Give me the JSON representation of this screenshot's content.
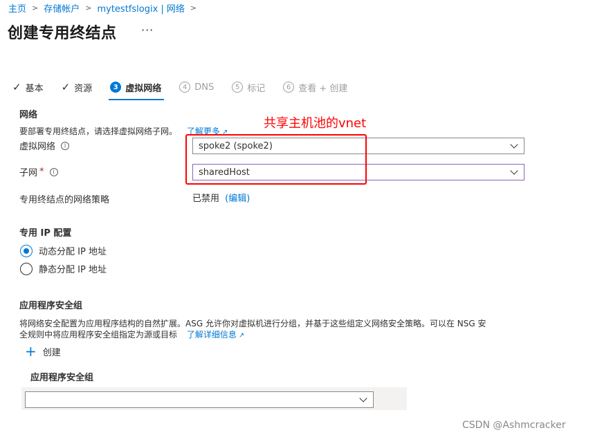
{
  "breadcrumb": {
    "home": "主页",
    "storage_accounts": "存储帐户",
    "resource": "mytestfslogix | 网络"
  },
  "page": {
    "title": "创建专用终结点",
    "more": "···"
  },
  "wizard": {
    "tabs": [
      {
        "label": "基本",
        "state": "done"
      },
      {
        "label": "资源",
        "state": "done"
      },
      {
        "number": "3",
        "label": "虚拟网络",
        "state": "active"
      },
      {
        "number": "4",
        "label": "DNS",
        "state": "disabled"
      },
      {
        "number": "5",
        "label": "标记",
        "state": "disabled"
      },
      {
        "number": "6",
        "label": "查看 + 创建",
        "state": "disabled"
      }
    ]
  },
  "network": {
    "title": "网络",
    "description": "要部署专用终结点，请选择虚拟网络子网。",
    "learn_more": "了解更多",
    "vnet_label": "虚拟网络",
    "vnet_value": "spoke2 (spoke2)",
    "subnet_label": "子网",
    "subnet_required": "*",
    "subnet_value": "sharedHost",
    "policy_label": "专用终结点的网络策略",
    "policy_value": "已禁用",
    "policy_edit": "(编辑)"
  },
  "annotation": {
    "text": "共享主机池的vnet",
    "color": "#ff0000"
  },
  "ip_config": {
    "title": "专用 IP 配置",
    "options": [
      {
        "label": "动态分配 IP 地址",
        "checked": true
      },
      {
        "label": "静态分配 IP 地址",
        "checked": false
      }
    ]
  },
  "asg": {
    "title": "应用程序安全组",
    "description_line1": "将网络安全配置为应用程序结构的自然扩展。ASG 允许你对虚拟机进行分组，并基于这些组定义网络安全策略。可以在 NSG 安",
    "description_line2": "全规则中将应用程序安全组指定为源或目标",
    "learn_detail": "了解详细信息",
    "create_label": "创建",
    "column_header": "应用程序安全组",
    "select_value": ""
  },
  "watermark": "CSDN @Ashmcracker",
  "colors": {
    "accent": "#0078d4",
    "annotation": "#ff0000",
    "required": "#a4262c"
  }
}
